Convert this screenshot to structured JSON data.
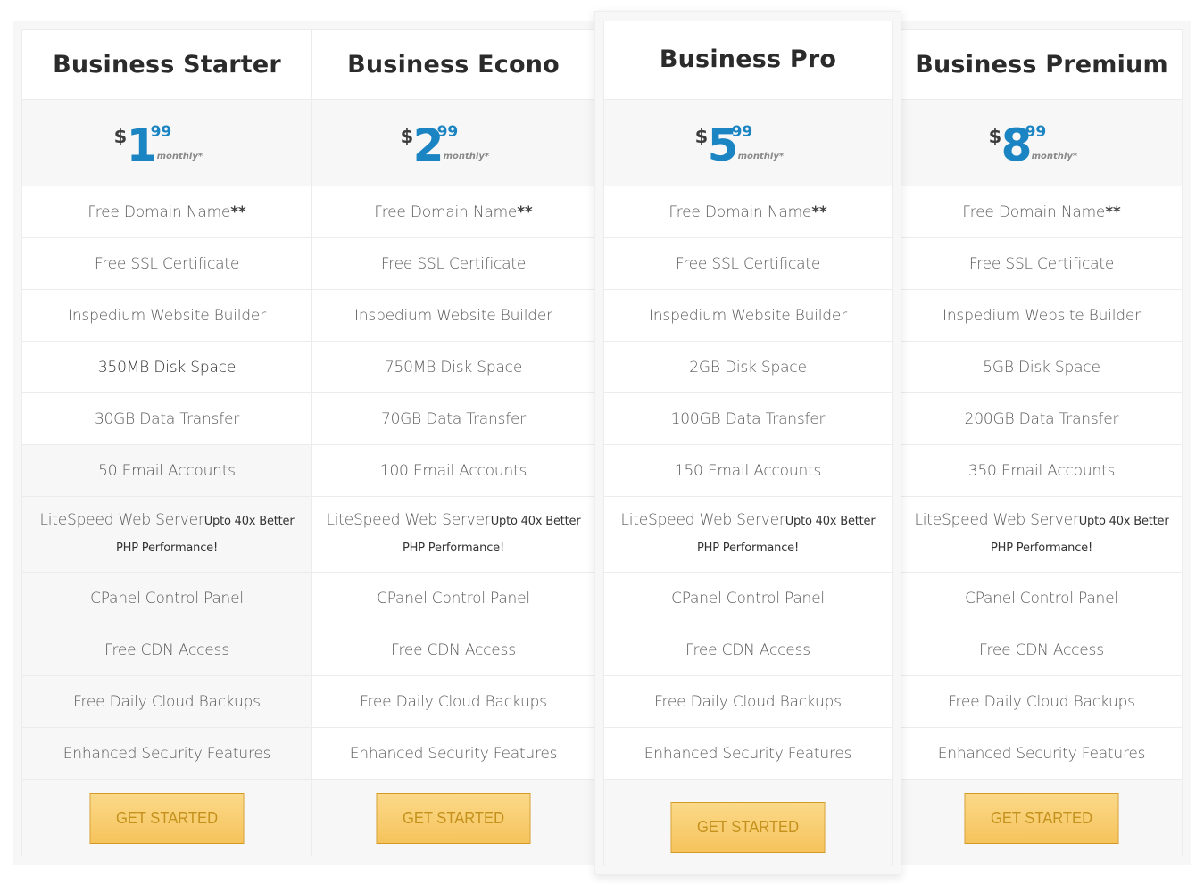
{
  "plans": [
    {
      "name": "Business Starter",
      "price": {
        "currency": "$",
        "integer": "1",
        "cents": "99",
        "period": "monthly*"
      },
      "features": {
        "domain": "Free Domain Name",
        "domain_suffix": "**",
        "ssl": "Free SSL Certificate",
        "builder": "Inspedium Website Builder",
        "disk": "350MB Disk Space",
        "transfer": "30GB Data Transfer",
        "email": "50 Email Accounts",
        "litespeed": "LiteSpeed Web Server",
        "litespeed_note": "Upto 40x Better PHP Performance!",
        "cpanel": "CPanel Control Panel",
        "cdn": "Free CDN Access",
        "backups": "Free Daily Cloud Backups",
        "security": "Enhanced Security Features"
      },
      "cta": "GET STARTED"
    },
    {
      "name": "Business Econo",
      "price": {
        "currency": "$",
        "integer": "2",
        "cents": "99",
        "period": "monthly*"
      },
      "features": {
        "domain": "Free Domain Name",
        "domain_suffix": "**",
        "ssl": "Free SSL Certificate",
        "builder": "Inspedium Website Builder",
        "disk": "750MB Disk Space",
        "transfer": "70GB Data Transfer",
        "email": "100 Email Accounts",
        "litespeed": "LiteSpeed Web Server",
        "litespeed_note": "Upto 40x Better PHP Performance!",
        "cpanel": "CPanel Control Panel",
        "cdn": "Free CDN Access",
        "backups": "Free Daily Cloud Backups",
        "security": "Enhanced Security Features"
      },
      "cta": "GET STARTED"
    },
    {
      "name": "Business Pro",
      "featured": true,
      "price": {
        "currency": "$",
        "integer": "5",
        "cents": "99",
        "period": "monthly*"
      },
      "features": {
        "domain": "Free Domain Name",
        "domain_suffix": "**",
        "ssl": "Free SSL Certificate",
        "builder": "Inspedium Website Builder",
        "disk": "2GB Disk Space",
        "transfer": "100GB Data Transfer",
        "email": "150 Email Accounts",
        "litespeed": "LiteSpeed Web Server",
        "litespeed_note": "Upto 40x Better PHP Performance!",
        "cpanel": "CPanel Control Panel",
        "cdn": "Free CDN Access",
        "backups": "Free Daily Cloud Backups",
        "security": "Enhanced Security Features"
      },
      "cta": "GET STARTED"
    },
    {
      "name": "Business Premium",
      "price": {
        "currency": "$",
        "integer": "8",
        "cents": "99",
        "period": "monthly*"
      },
      "features": {
        "domain": "Free Domain Name",
        "domain_suffix": "**",
        "ssl": "Free SSL Certificate",
        "builder": "Inspedium Website Builder",
        "disk": "5GB Disk Space",
        "transfer": "200GB Data Transfer",
        "email": "350 Email Accounts",
        "litespeed": "LiteSpeed Web Server",
        "litespeed_note": "Upto 40x Better PHP Performance!",
        "cpanel": "CPanel Control Panel",
        "cdn": "Free CDN Access",
        "backups": "Free Daily Cloud Backups",
        "security": "Enhanced Security Features"
      },
      "cta": "GET STARTED"
    }
  ],
  "colors": {
    "price_accent": "#1b84c2",
    "button_fill": "#f6c35c",
    "button_text": "#c4911c"
  }
}
